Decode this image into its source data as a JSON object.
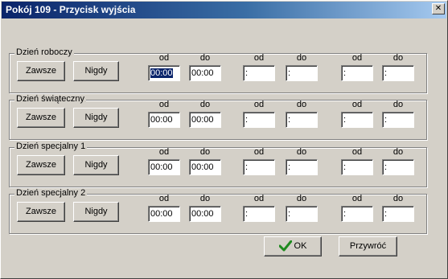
{
  "window": {
    "title": "Pokój 109 - Przycisk wyjścia",
    "close_glyph": "✕"
  },
  "column_headers": [
    "od",
    "do",
    "od",
    "do",
    "od",
    "do"
  ],
  "buttons": {
    "always": "Zawsze",
    "never": "Nigdy"
  },
  "groups": [
    {
      "label": "Dzień roboczy",
      "times": [
        "00:00",
        "00:00",
        " :",
        " :",
        " :",
        " :"
      ]
    },
    {
      "label": "Dzień świąteczny",
      "times": [
        "00:00",
        "00:00",
        " :",
        " :",
        " :",
        " :"
      ]
    },
    {
      "label": "Dzień specjalny 1",
      "times": [
        "00:00",
        "00:00",
        " :",
        " :",
        " :",
        " :"
      ]
    },
    {
      "label": "Dzień specjalny 2",
      "times": [
        "00:00",
        "00:00",
        " :",
        " :",
        " :",
        " :"
      ]
    }
  ],
  "footer": {
    "ok_label": "OK",
    "restore_label": "Przywróć"
  },
  "colors": {
    "checkmark": "#1f8a1f",
    "selection": "#0a246a",
    "titlebar": "#0a246a"
  }
}
